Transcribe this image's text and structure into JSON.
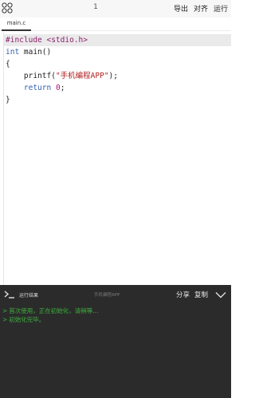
{
  "toolbar": {
    "menu_icon": "grid-menu-icon",
    "line_number": "1",
    "export_label": "导出",
    "align_label": "对齐",
    "run_label": "运行"
  },
  "tabs": [
    {
      "label": "main.c",
      "active": true
    }
  ],
  "editor": {
    "lines": [
      {
        "directive": "#include",
        "header": " <stdio.h>"
      },
      {
        "type": "int",
        "rest": " main()"
      },
      {
        "text": "{"
      },
      {
        "indent": "    ",
        "func": "printf(",
        "string": "\"手机编程APP\"",
        "tail": ");"
      },
      {
        "indent": "    ",
        "keyword": "return",
        "space": " ",
        "number": "0",
        "tail": ";"
      },
      {
        "text": "}"
      }
    ]
  },
  "panel": {
    "icon": "terminal-icon",
    "title": "运行结果",
    "center_text": "手机编程APP",
    "share_label": "分享",
    "copy_label": "复制",
    "collapse_icon": "chevron-down-icon"
  },
  "console": {
    "prompt": ">",
    "lines": [
      "首次使用，正在初始化，请稍等...",
      "初始化完毕。"
    ]
  },
  "colors": {
    "keyword": "#2f5fb3",
    "preprocessor": "#8a1f6a",
    "string": "#b02020",
    "number": "#b0107a",
    "console_text": "#3db23d",
    "panel_bg": "#2b2b2b"
  }
}
